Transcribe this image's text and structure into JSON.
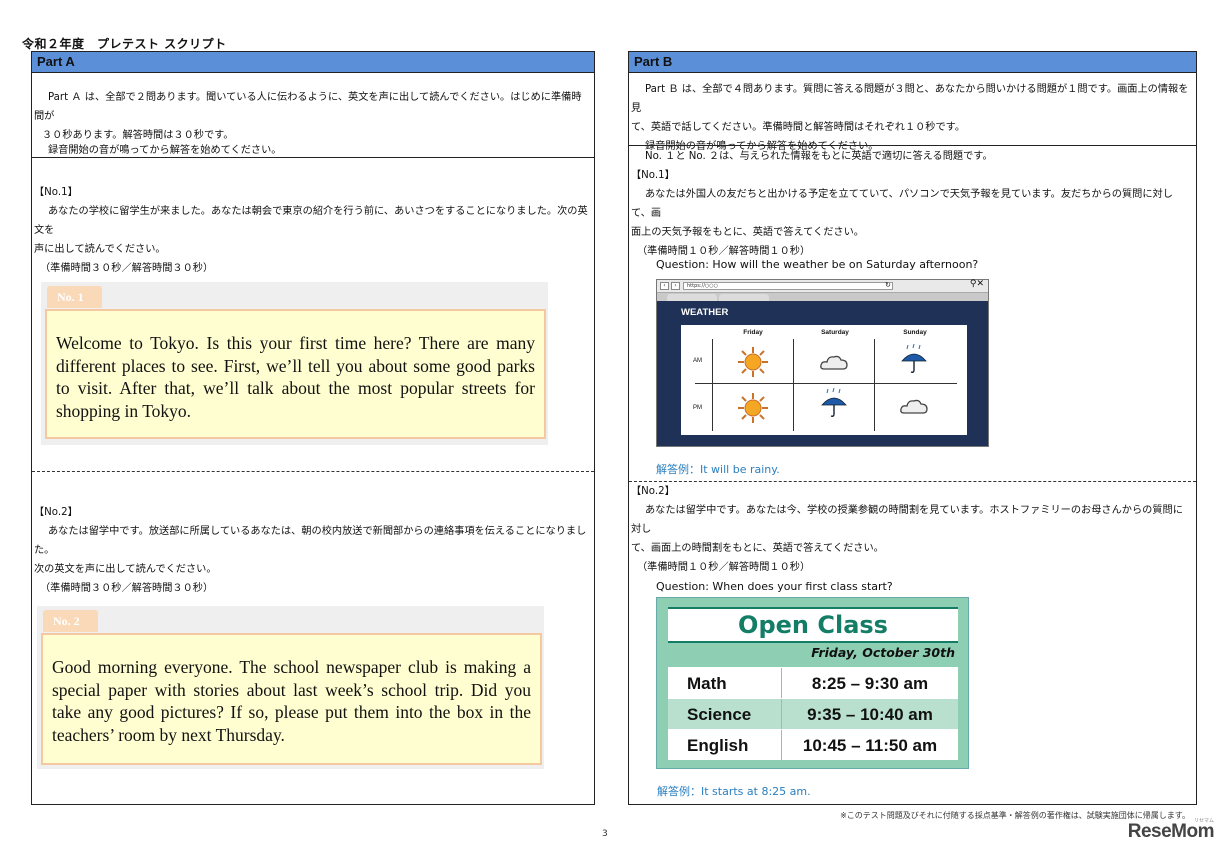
{
  "doc_title": "令和２年度　プレテスト スクリプト",
  "part_a": {
    "header": "Part A",
    "intro_line1": "Part Ａ は、全部で２問あります。聞いている人に伝わるように、英文を声に出して読んでください。はじめに準備時間が",
    "intro_line2": "３０秒あります。解答時間は３０秒です。",
    "intro_line3": "録音開始の音が鳴ってから解答を始めてください。",
    "q1": {
      "label": "【No.1】",
      "line1": "あなたの学校に留学生が来ました。あなたは朝会で東京の紹介を行う前に、あいさつをすることになりました。次の英文を",
      "line2": "声に出して読んでください。",
      "timing": "（準備時間３０秒／解答時間３０秒）",
      "tab": "No. 1",
      "passage": "Welcome to Tokyo. Is this your first time here? There are many different places to see. First, we’ll tell you about some good parks to visit. After that, we’ll talk about the most popular streets for shopping in Tokyo."
    },
    "q2": {
      "label": "【No.2】",
      "line1": "あなたは留学中です。放送部に所属しているあなたは、朝の校内放送で新聞部からの連絡事項を伝えることになりました。",
      "line2": "次の英文を声に出して読んでください。",
      "timing": "（準備時間３０秒／解答時間３０秒）",
      "tab": "No. 2",
      "passage": "Good morning everyone. The school newspaper club is making a special paper with stories about last week’s school trip. Did you take any good pictures? If so, please put them into the box in the teachers’ room by next Thursday."
    }
  },
  "part_b": {
    "header": "Part B",
    "intro_line1": "Part Ｂ は、全部で４問あります。質問に答える問題が３問と、あなたから問いかける問題が１問です。画面上の情報を見",
    "intro_line2": "て、英語で話してください。準備時間と解答時間はそれぞれ１０秒です。",
    "intro_line3": "録音開始の音が鳴ってから解答を始めてください。",
    "section_intro": "No. １と No. ２は、与えられた情報をもとに英語で適切に答える問題です。",
    "q1": {
      "label": "【No.1】",
      "line1": "あなたは外国人の友だちと出かける予定を立てていて、パソコンで天気予報を見ています。友だちからの質問に対して、画",
      "line2": "面上の天気予報をもとに、英語で答えてください。",
      "timing": "（準備時間１０秒／解答時間１０秒）",
      "question": "Question:  How will the weather  be on Saturday afternoon?",
      "answer": "解答例：It will be rainy."
    },
    "weather": {
      "url": "https://○○○",
      "title": "WEATHER",
      "days": [
        "Friday",
        "Saturday",
        "Sunday"
      ],
      "rows": [
        "AM",
        "PM"
      ],
      "am": [
        "sunny",
        "cloudy",
        "rainy"
      ],
      "pm": [
        "sunny",
        "rainy",
        "cloudy"
      ]
    },
    "q2": {
      "label": "【No.2】",
      "line1": "あなたは留学中です。あなたは今、学校の授業参観の時間割を見ています。ホストファミリーのお母さんからの質問に対し",
      "line2": "て、画面上の時間割をもとに、英語で答えてください。",
      "timing": "（準備時間１０秒／解答時間１０秒）",
      "question": "Question:  When does your first class start?",
      "answer": "解答例：It starts at 8:25 am."
    },
    "open_class": {
      "title": "Open Class",
      "date": "Friday, October 30th",
      "rows": [
        {
          "subject": "Math",
          "time": "8:25 – 9:30 am"
        },
        {
          "subject": "Science",
          "time": "9:35 – 10:40 am"
        },
        {
          "subject": "English",
          "time": "10:45 – 11:50 am"
        }
      ]
    }
  },
  "footer_note": "※このテスト問題及びそれに付随する採点基準・解答例の著作権は、試験実施団体に帰属します。",
  "page_number": "3",
  "logo": "ReseMom",
  "logo_ruby": "リセマム"
}
